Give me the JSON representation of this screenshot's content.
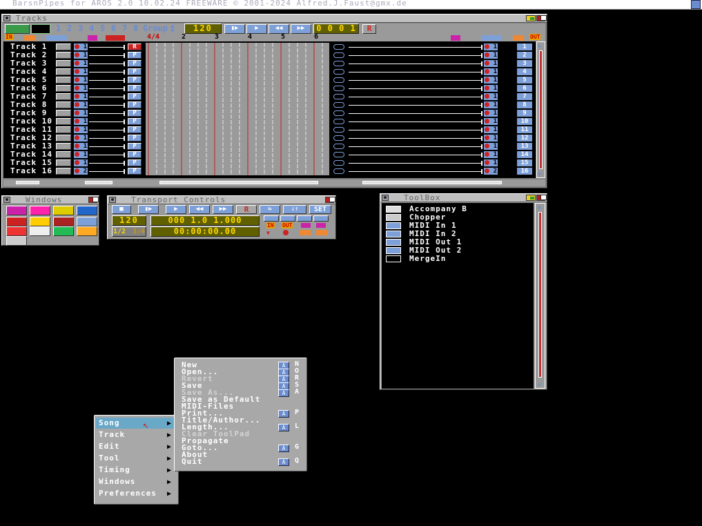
{
  "screen": {
    "title": "BarsnPipes for AROS 2.0 10.02.24 FREEWARE © 2001-2024 Alfred.J.Faust@gmx.de"
  },
  "tracks_window": {
    "title": "Tracks",
    "tempo": "120",
    "position": "0 0 0 1",
    "record_label": "R",
    "group_numbers": [
      "1",
      "2",
      "3",
      "4",
      "5",
      "6",
      "7",
      "8"
    ],
    "group_label": "Group",
    "in_label": "IN",
    "out_label": "OUT",
    "time_signature": "4/4",
    "measures": [
      "2",
      "3",
      "4",
      "5",
      "6"
    ],
    "tracks": [
      {
        "name": "Track 1",
        "num": "1",
        "in_ch": "1",
        "out_ch": "1",
        "mode": "R"
      },
      {
        "name": "Track 2",
        "num": "2",
        "in_ch": "1",
        "out_ch": "1",
        "mode": "P"
      },
      {
        "name": "Track 3",
        "num": "3",
        "in_ch": "1",
        "out_ch": "1",
        "mode": "P"
      },
      {
        "name": "Track 4",
        "num": "4",
        "in_ch": "1",
        "out_ch": "1",
        "mode": "P"
      },
      {
        "name": "Track 5",
        "num": "5",
        "in_ch": "1",
        "out_ch": "1",
        "mode": "P"
      },
      {
        "name": "Track 6",
        "num": "6",
        "in_ch": "1",
        "out_ch": "1",
        "mode": "P"
      },
      {
        "name": "Track 7",
        "num": "7",
        "in_ch": "1",
        "out_ch": "1",
        "mode": "P"
      },
      {
        "name": "Track 8",
        "num": "8",
        "in_ch": "1",
        "out_ch": "1",
        "mode": "P"
      },
      {
        "name": "Track 9",
        "num": "9",
        "in_ch": "1",
        "out_ch": "1",
        "mode": "P"
      },
      {
        "name": "Track 10",
        "num": "10",
        "in_ch": "1",
        "out_ch": "1",
        "mode": "P"
      },
      {
        "name": "Track 11",
        "num": "11",
        "in_ch": "1",
        "out_ch": "1",
        "mode": "P"
      },
      {
        "name": "Track 12",
        "num": "12",
        "in_ch": "1",
        "out_ch": "1",
        "mode": "P"
      },
      {
        "name": "Track 13",
        "num": "13",
        "in_ch": "1",
        "out_ch": "1",
        "mode": "P"
      },
      {
        "name": "Track 14",
        "num": "14",
        "in_ch": "1",
        "out_ch": "1",
        "mode": "P"
      },
      {
        "name": "Track 15",
        "num": "15",
        "in_ch": "1",
        "out_ch": "1",
        "mode": "P"
      },
      {
        "name": "Track 16",
        "num": "16",
        "in_ch": "2",
        "out_ch": "2",
        "mode": "P"
      }
    ]
  },
  "windows_window": {
    "title": "Windows"
  },
  "transport_window": {
    "title": "Transport Controls",
    "record_label": "R",
    "set_label": "SET",
    "tempo": "120",
    "position": "000 1.0 1.000",
    "time": "00:00:00.00",
    "meter": "1/2",
    "meter2": "3/4",
    "in_label": "IN",
    "out_label": "OUT"
  },
  "toolbox_window": {
    "title": "ToolBox",
    "items": [
      "Accompany B",
      "Chopper",
      "MIDI In 1",
      "MIDI In 2",
      "MIDI Out 1",
      "MIDI Out 2",
      "MergeIn"
    ]
  },
  "menu": {
    "items": [
      "Song",
      "Track",
      "Edit",
      "Tool",
      "Timing",
      "Windows",
      "Preferences"
    ],
    "song_submenu": [
      {
        "label": "New",
        "key": "N"
      },
      {
        "label": "Open...",
        "key": "O"
      },
      {
        "label": "Revert",
        "key": "R"
      },
      {
        "label": "Save",
        "key": "S"
      },
      {
        "label": "Save As...",
        "key": "A"
      },
      {
        "label": "Save as Default",
        "key": ""
      },
      {
        "label": "MIDI-Files",
        "key": ""
      },
      {
        "label": "Print...",
        "key": "P"
      },
      {
        "label": "Title/Author...",
        "key": ""
      },
      {
        "label": "Length...",
        "key": "L"
      },
      {
        "label": "Clear ToolPad",
        "key": ""
      },
      {
        "label": "Propagate",
        "key": ""
      },
      {
        "label": "Goto...",
        "key": "G"
      },
      {
        "label": "About",
        "key": ""
      },
      {
        "label": "Quit",
        "key": "Q"
      }
    ]
  }
}
